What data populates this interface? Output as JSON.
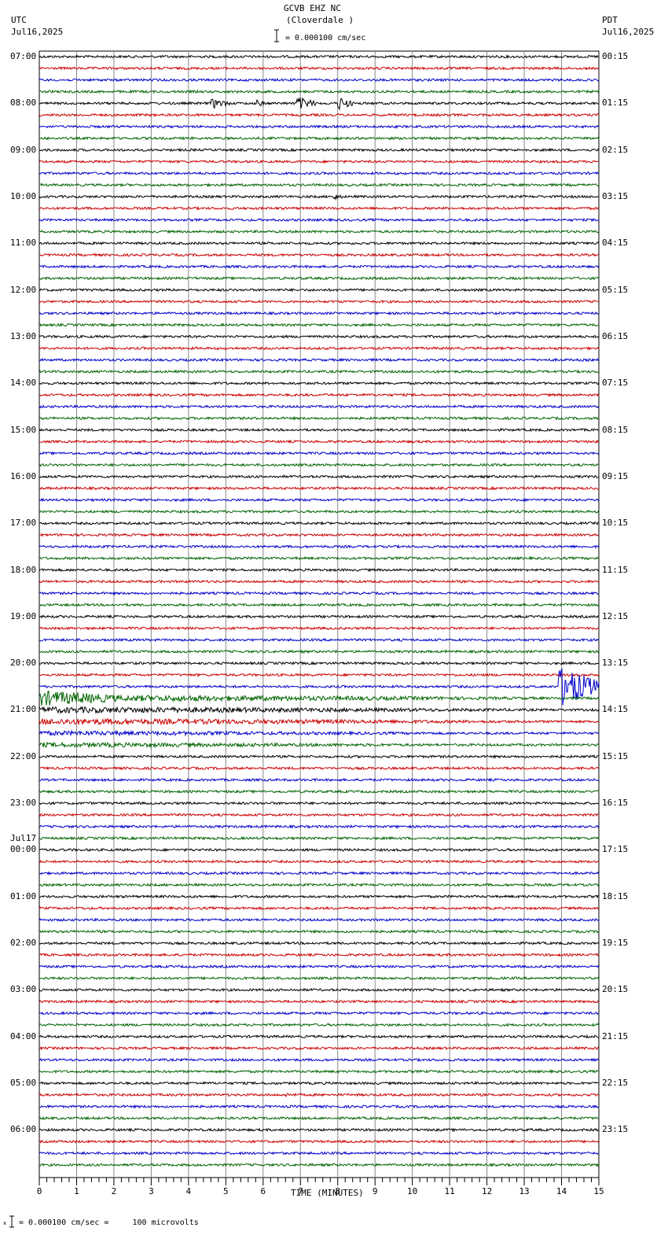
{
  "header": {
    "station": "GCVB EHZ NC",
    "location": "(Cloverdale )",
    "scale": "= 0.000100 cm/sec",
    "left_tz": "UTC",
    "left_date": "Jul16,2025",
    "right_tz": "PDT",
    "right_date": "Jul16,2025"
  },
  "footer": {
    "scale": "= 0.000100 cm/sec =     100 microvolts",
    "mark": "x"
  },
  "chart_data": {
    "type": "line",
    "title": "GCVB EHZ NC (Cloverdale )",
    "xlabel": "TIME (MINUTES)",
    "xlim": [
      0,
      15
    ],
    "x_ticks": [
      "0",
      "1",
      "2",
      "3",
      "4",
      "5",
      "6",
      "7",
      "8",
      "9",
      "10",
      "11",
      "12",
      "13",
      "14",
      "15"
    ],
    "traces_per_hour": 4,
    "trace_colors": [
      "#000000",
      "#cc0000",
      "#0000cc",
      "#006400"
    ],
    "left_labels": [
      "07:00",
      "08:00",
      "09:00",
      "10:00",
      "11:00",
      "12:00",
      "13:00",
      "14:00",
      "15:00",
      "16:00",
      "17:00",
      "18:00",
      "19:00",
      "20:00",
      "21:00",
      "22:00",
      "23:00",
      "00:00",
      "01:00",
      "02:00",
      "03:00",
      "04:00",
      "05:00",
      "06:00"
    ],
    "date_change_label": "Jul17",
    "date_change_index": 17,
    "right_labels": [
      "00:15",
      "01:15",
      "02:15",
      "03:15",
      "04:15",
      "05:15",
      "06:15",
      "07:15",
      "08:15",
      "09:15",
      "10:15",
      "11:15",
      "12:15",
      "13:15",
      "14:15",
      "15:15",
      "16:15",
      "17:15",
      "18:15",
      "19:15",
      "20:15",
      "21:15",
      "22:15",
      "23:15"
    ],
    "events": [
      {
        "trace": 4,
        "start_min": 4.6,
        "end_min": 5.1,
        "amplitude": 7
      },
      {
        "trace": 4,
        "start_min": 5.8,
        "end_min": 6.1,
        "amplitude": 5
      },
      {
        "trace": 4,
        "start_min": 6.9,
        "end_min": 7.4,
        "amplitude": 9
      },
      {
        "trace": 4,
        "start_min": 8.0,
        "end_min": 8.4,
        "amplitude": 9
      },
      {
        "trace": 12,
        "start_min": 7.9,
        "end_min": 8.2,
        "amplitude": 4
      },
      {
        "trace": 54,
        "start_min": 13.9,
        "end_min": 15,
        "amplitude": 26
      },
      {
        "trace": 55,
        "start_min": 0,
        "end_min": 2.5,
        "amplitude": 10
      },
      {
        "trace": 55,
        "start_min": 2.5,
        "end_min": 15,
        "amplitude": 4
      },
      {
        "trace": 56,
        "start_min": 0,
        "end_min": 15,
        "amplitude": 4
      },
      {
        "trace": 57,
        "start_min": 0,
        "end_min": 15,
        "amplitude": 4
      },
      {
        "trace": 58,
        "start_min": 0,
        "end_min": 15,
        "amplitude": 3
      },
      {
        "trace": 59,
        "start_min": 0,
        "end_min": 15,
        "amplitude": 3
      },
      {
        "trace": 89,
        "start_min": 6.6,
        "end_min": 7.0,
        "amplitude": 3
      }
    ],
    "noise_amplitude": 1.5
  }
}
